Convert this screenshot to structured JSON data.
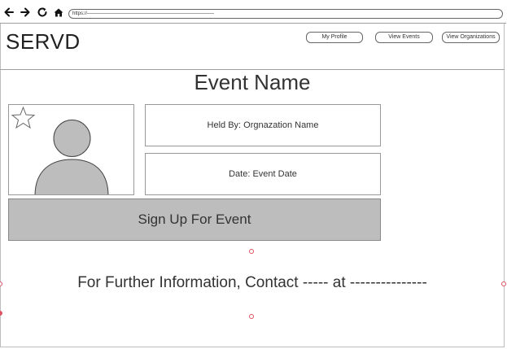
{
  "browser": {
    "url": "https://——————————————————————————",
    "icons": [
      "back-arrow-icon",
      "forward-arrow-icon",
      "reload-icon",
      "home-icon"
    ]
  },
  "header": {
    "logo": "SERVD",
    "nav": [
      {
        "label": "My  Profile"
      },
      {
        "label": "View Events"
      },
      {
        "label": "View Organizations"
      }
    ]
  },
  "event": {
    "title": "Event Name",
    "held_by": "Held By: Orgnazation Name",
    "date": "Date: Event Date",
    "signup_label": "Sign Up For Event",
    "image_icons": [
      "star-icon",
      "person-avatar-icon"
    ]
  },
  "footer": {
    "contact": "For Further Information, Contact ----- at ---------------"
  },
  "colors": {
    "button_fill": "#bdbdbd",
    "border": "#999999",
    "selection_handle": "#e05060"
  }
}
